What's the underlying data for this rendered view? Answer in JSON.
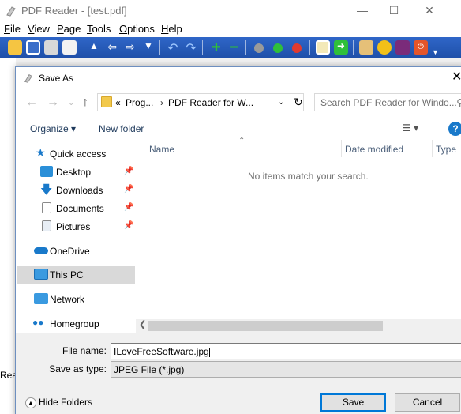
{
  "app": {
    "title": "PDF Reader - [test.pdf]",
    "menu": [
      "File",
      "View",
      "Page",
      "Tools",
      "Options",
      "Help"
    ],
    "status_text": "Rea"
  },
  "dialog": {
    "title": "Save As",
    "address": {
      "overflow": "«",
      "crumb1": "Prog...",
      "crumb2": "PDF Reader for W..."
    },
    "search_placeholder": "Search PDF Reader for Windo...",
    "organize_label": "Organize ▾",
    "new_folder_label": "New folder",
    "nav": {
      "quick_access": "Quick access",
      "desktop": "Desktop",
      "downloads": "Downloads",
      "documents": "Documents",
      "pictures": "Pictures",
      "onedrive": "OneDrive",
      "this_pc": "This PC",
      "network": "Network",
      "homegroup": "Homegroup"
    },
    "columns": {
      "name": "Name",
      "date_modified": "Date modified",
      "type": "Type"
    },
    "empty_message": "No items match your search.",
    "file_name_label": "File name:",
    "file_name_value": "ILoveFreeSoftware.jpg",
    "save_as_type_label": "Save as type:",
    "save_as_type_value": "JPEG File (*.jpg)",
    "hide_folders_label": "Hide Folders",
    "save_label": "Save",
    "cancel_label": "Cancel"
  }
}
